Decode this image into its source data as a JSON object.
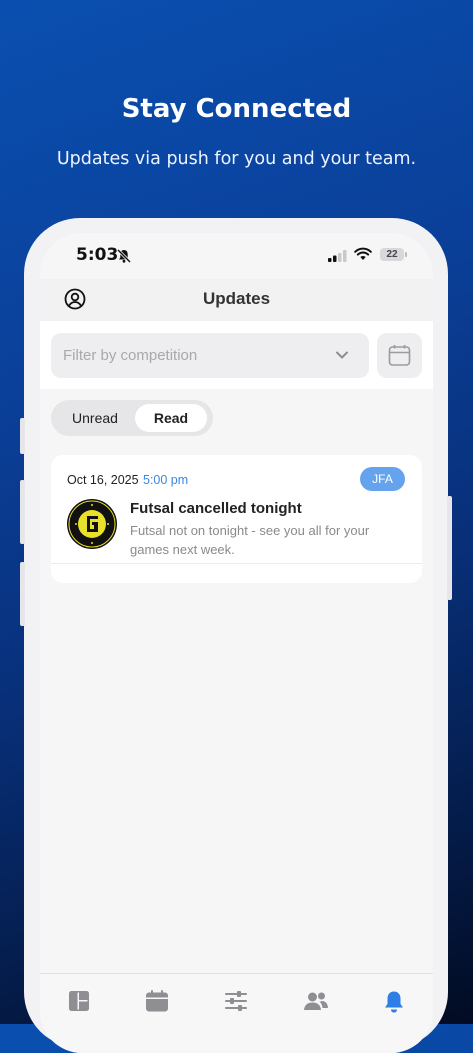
{
  "promo": {
    "headline": "Stay Connected",
    "subline": "Updates via push for you and your team."
  },
  "status_bar": {
    "time": "5:03",
    "battery": "22",
    "icons": [
      "bell-slash-icon",
      "cellular-signal-icon",
      "wifi-icon",
      "battery-icon"
    ]
  },
  "header": {
    "title": "Updates",
    "profile_icon": "user-circle-icon"
  },
  "filter": {
    "placeholder": "Filter by competition",
    "dropdown_icon": "chevron-down-icon",
    "calendar_icon": "calendar-icon"
  },
  "segment": {
    "unread_label": "Unread",
    "read_label": "Read",
    "selected": "Read"
  },
  "notifications": [
    {
      "date": "Oct 16, 2025",
      "time": "5:00 pm",
      "tag": "JFA",
      "title": "Futsal cancelled tonight",
      "body": "Futsal not on tonight - see you all for your games next week.",
      "logo": "just-futsal-academy-logo"
    }
  ],
  "tab_bar": {
    "items": [
      "dashboard-icon",
      "calendar-icon",
      "sliders-icon",
      "users-icon",
      "bell-icon"
    ],
    "active": "bell-icon"
  },
  "colors": {
    "accent": "#3a86e6",
    "tag": "#66a3ef",
    "bg_top": "#0a4fb0",
    "bg_bottom": "#020b22"
  }
}
